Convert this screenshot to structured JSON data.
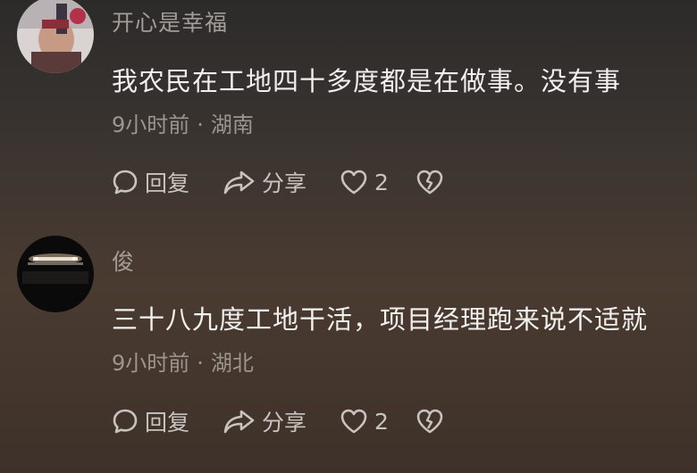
{
  "comments": [
    {
      "username": "开心是幸福",
      "text": "我农民在工地四十多度都是在做事。没有事",
      "time": "9小时前",
      "location": "湖南",
      "reply_label": "回复",
      "share_label": "分享",
      "like_count": "2"
    },
    {
      "username": "俊",
      "text": "三十八九度工地干活，项目经理跑来说不适就",
      "time": "9小时前",
      "location": "湖北",
      "reply_label": "回复",
      "share_label": "分享",
      "like_count": "2"
    }
  ],
  "separator": "·",
  "icons": [
    "comment-bubble-icon",
    "share-arrow-icon",
    "heart-icon",
    "broken-heart-icon"
  ]
}
